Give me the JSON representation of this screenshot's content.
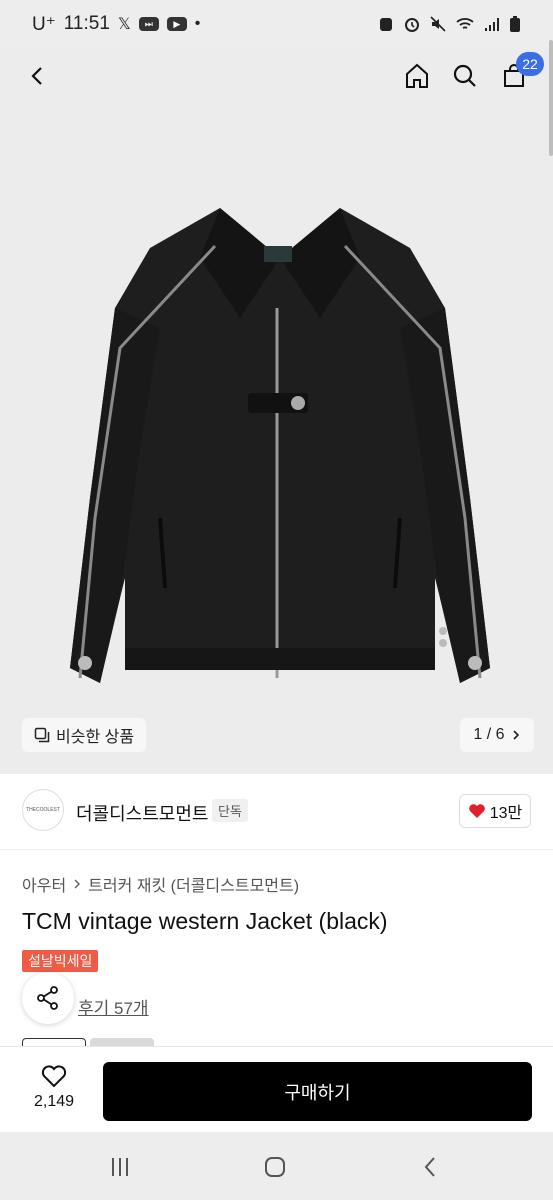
{
  "status_bar": {
    "carrier": "U⁺",
    "time": "11:51"
  },
  "top_nav": {
    "cart_count": "22"
  },
  "gallery": {
    "similar_label": "비슷한 상품",
    "page_indicator": "1 / 6"
  },
  "brand": {
    "logo_text": "THECOOLEST",
    "name": "더콜디스트모먼트",
    "tag": "단독",
    "likes": "13만"
  },
  "breadcrumb": {
    "level1": "아우터",
    "level2": "트러커 재킷 (더콜디스트모먼트)"
  },
  "product": {
    "title": "TCM vintage western Jacket (black)",
    "sale_badge": "설날빅세일",
    "review_text": "후기 57개"
  },
  "bottom_bar": {
    "wish_count": "2,149",
    "buy_label": "구매하기"
  },
  "colors": {
    "badge_blue": "#3a6ee8",
    "sale_red": "#ef5b45",
    "heart_red": "#e0202a",
    "buy_black": "#000000"
  }
}
